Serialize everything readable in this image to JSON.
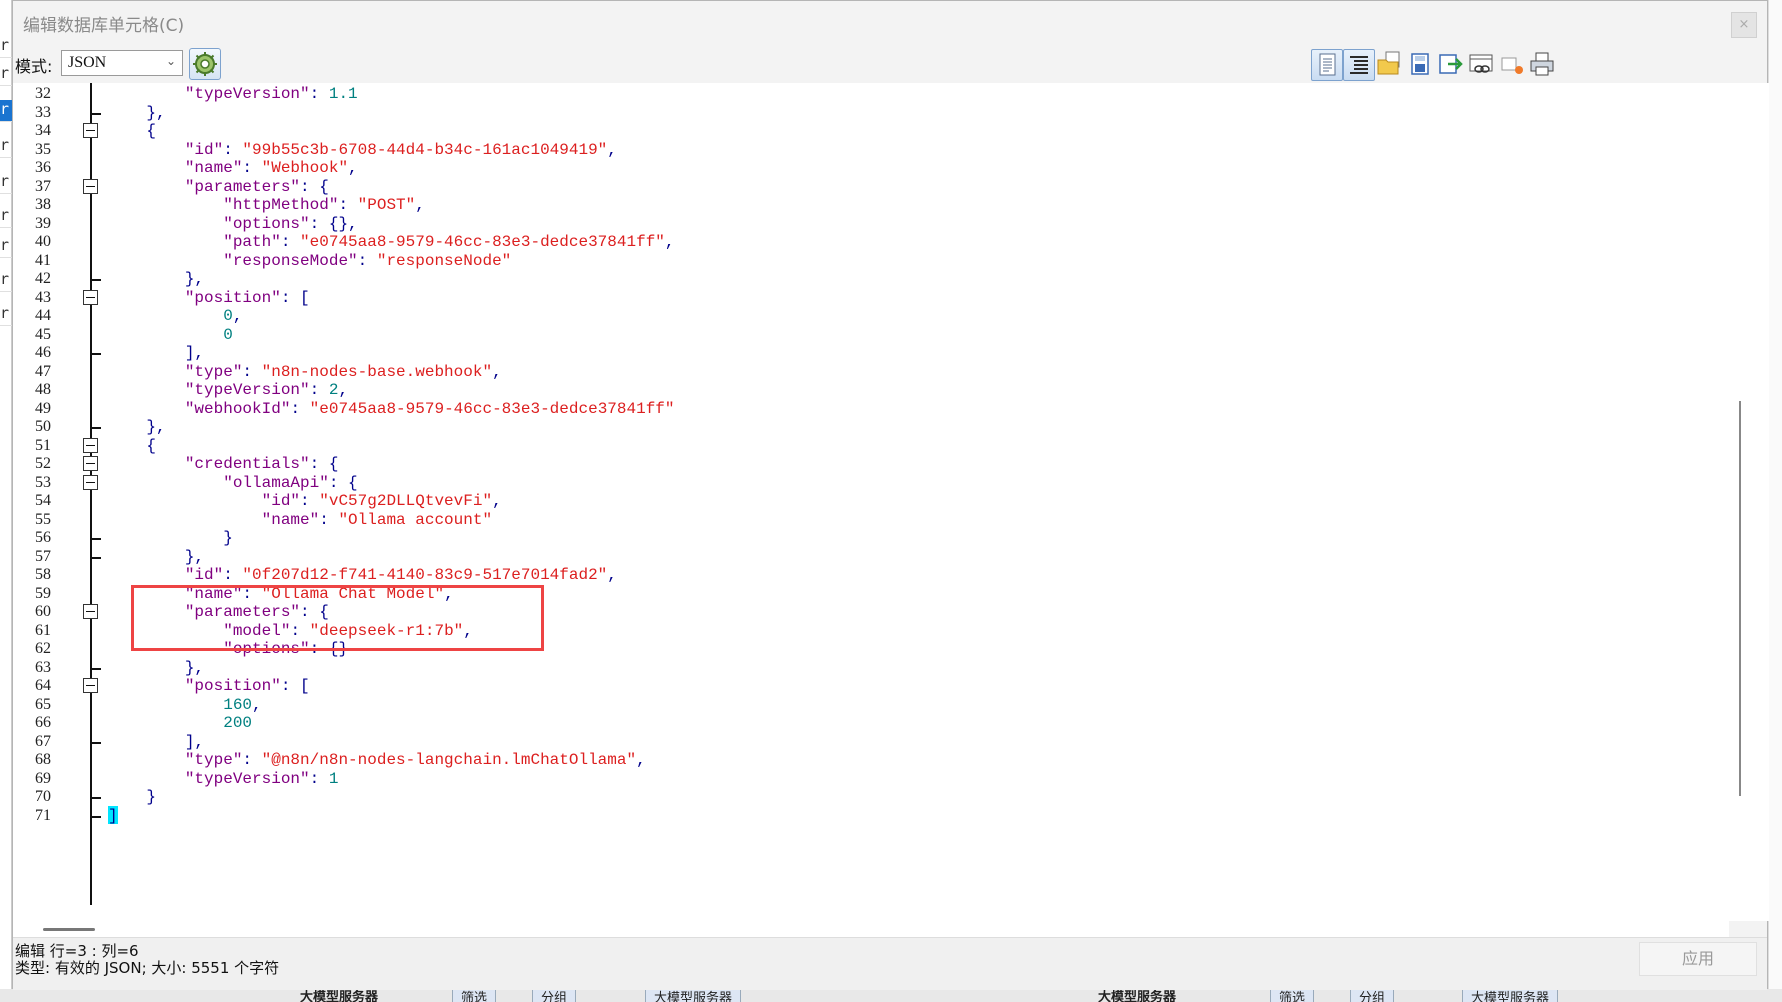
{
  "window": {
    "title": "编辑数据库单元格(C)",
    "close_label": "×"
  },
  "toolbar": {
    "mode_label": "模式:",
    "mode_value": "JSON",
    "buttons": [
      "text-mode-icon",
      "indent-mode-icon",
      "open-file-icon",
      "save-icon",
      "export-icon",
      "link-icon",
      "clear-icon",
      "print-icon"
    ]
  },
  "editor": {
    "lines": [
      {
        "num": "32",
        "code": "        \"typeVersion\": 1.1"
      },
      {
        "num": "33",
        "code": "    },"
      },
      {
        "num": "34",
        "code": "    {"
      },
      {
        "num": "35",
        "code": "        \"id\": \"99b55c3b-6708-44d4-b34c-161ac1049419\","
      },
      {
        "num": "36",
        "code": "        \"name\": \"Webhook\","
      },
      {
        "num": "37",
        "code": "        \"parameters\": {"
      },
      {
        "num": "38",
        "code": "            \"httpMethod\": \"POST\","
      },
      {
        "num": "39",
        "code": "            \"options\": {},"
      },
      {
        "num": "40",
        "code": "            \"path\": \"e0745aa8-9579-46cc-83e3-dedce37841ff\","
      },
      {
        "num": "41",
        "code": "            \"responseMode\": \"responseNode\""
      },
      {
        "num": "42",
        "code": "        },"
      },
      {
        "num": "43",
        "code": "        \"position\": ["
      },
      {
        "num": "44",
        "code": "            0,"
      },
      {
        "num": "45",
        "code": "            0"
      },
      {
        "num": "46",
        "code": "        ],"
      },
      {
        "num": "47",
        "code": "        \"type\": \"n8n-nodes-base.webhook\","
      },
      {
        "num": "48",
        "code": "        \"typeVersion\": 2,"
      },
      {
        "num": "49",
        "code": "        \"webhookId\": \"e0745aa8-9579-46cc-83e3-dedce37841ff\""
      },
      {
        "num": "50",
        "code": "    },"
      },
      {
        "num": "51",
        "code": "    {"
      },
      {
        "num": "52",
        "code": "        \"credentials\": {"
      },
      {
        "num": "53",
        "code": "            \"ollamaApi\": {"
      },
      {
        "num": "54",
        "code": "                \"id\": \"vC57g2DLLQtvevFi\","
      },
      {
        "num": "55",
        "code": "                \"name\": \"Ollama account\""
      },
      {
        "num": "56",
        "code": "            }"
      },
      {
        "num": "57",
        "code": "        },"
      },
      {
        "num": "58",
        "code": "        \"id\": \"0f207d12-f741-4140-83c9-517e7014fad2\","
      },
      {
        "num": "59",
        "code": "        \"name\": \"Ollama Chat Model\","
      },
      {
        "num": "60",
        "code": "        \"parameters\": {"
      },
      {
        "num": "61",
        "code": "            \"model\": \"deepseek-r1:7b\","
      },
      {
        "num": "62",
        "code": "            \"options\": {}"
      },
      {
        "num": "63",
        "code": "        },"
      },
      {
        "num": "64",
        "code": "        \"position\": ["
      },
      {
        "num": "65",
        "code": "            160,"
      },
      {
        "num": "66",
        "code": "            200"
      },
      {
        "num": "67",
        "code": "        ],"
      },
      {
        "num": "68",
        "code": "        \"type\": \"@n8n/n8n-nodes-langchain.lmChatOllama\","
      },
      {
        "num": "69",
        "code": "        \"typeVersion\": 1"
      },
      {
        "num": "70",
        "code": "    }"
      },
      {
        "num": "71",
        "code": "]"
      }
    ]
  },
  "status": {
    "line1": "编辑 行=3 : 列=6",
    "line2": "类型: 有效的 JSON; 大小: 5551 个字符",
    "apply_label": "应用"
  },
  "background": {
    "bottom_text_1": "大模型服务器",
    "bottom_tag_1": "筛选",
    "bottom_tag_2": "分组",
    "bottom_tag_3": "大模型服务器"
  }
}
